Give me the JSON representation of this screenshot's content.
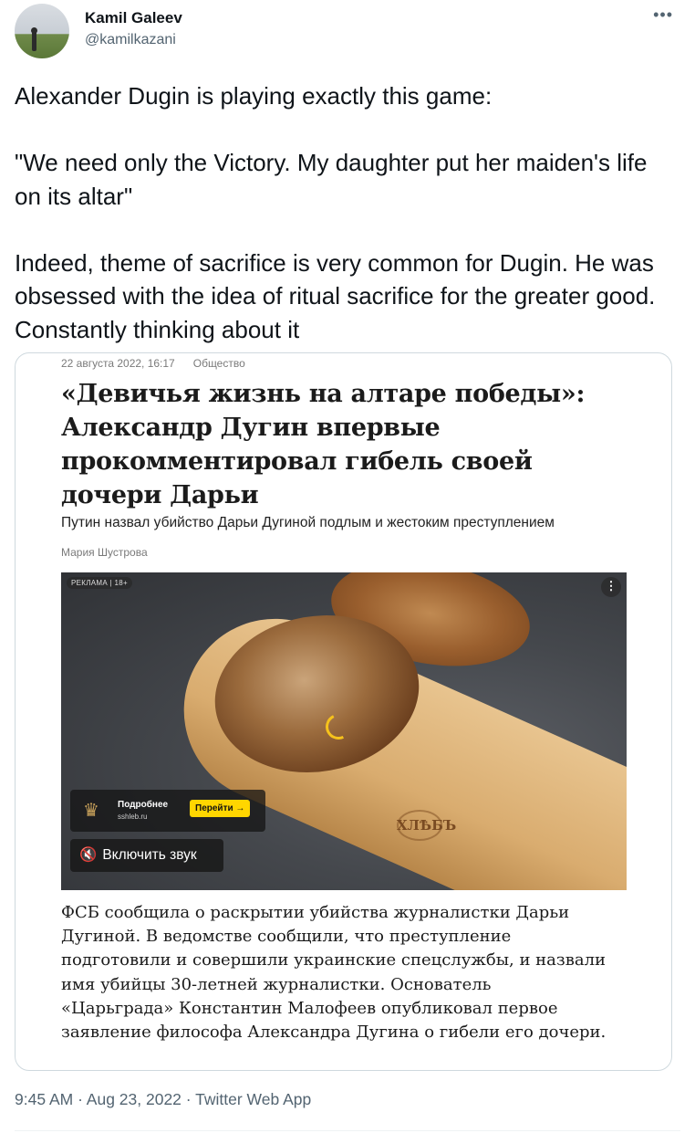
{
  "author": {
    "display_name": "Kamil Galeev",
    "handle": "@kamilkazani",
    "more_icon": "more-horizontal-icon"
  },
  "tweet": {
    "text": "Alexander Dugin is playing exactly this game:\n\n\"We need only the Victory. My daughter put her maiden's life on its altar\"\n\nIndeed, theme of sacrifice is very common for Dugin. He was obsessed with the idea of ritual sacrifice for the greater good. Constantly thinking about it",
    "timestamp": "9:45 AM · Aug 23, 2022 · Twitter Web App"
  },
  "article": {
    "date": "22 августа 2022, 16:17",
    "category": "Общество",
    "headline": "«Девичья жизнь на алтаре победы»: Александр Дугин впервые прокомментировал гибель своей дочери Дарьи",
    "subtitle": "Путин назвал убийство Дарьи Дугиной подлым и жестоким преступлением",
    "author": "Мария Шустрова",
    "body": "ФСБ сообщила о раскрытии убийства журналистки Дарьи Дугиной. В ведомстве сообщили, что преступление подготовили и совершили украинские спецслужбы, и назвали имя убийцы 30-летней журналистки. Основатель «Царьграда» Константин Малофеев опубликовал первое заявление философа Александра Дугина о гибели его дочери."
  },
  "ad": {
    "label": "РЕКЛАМА | 18+",
    "more_label": "Подробнее",
    "domain": "sshleb.ru",
    "go_button": "Перейти →",
    "sound_button": "Включить звук",
    "brand": "ХЛѢБЪ",
    "accent_color": "#ffd600"
  }
}
